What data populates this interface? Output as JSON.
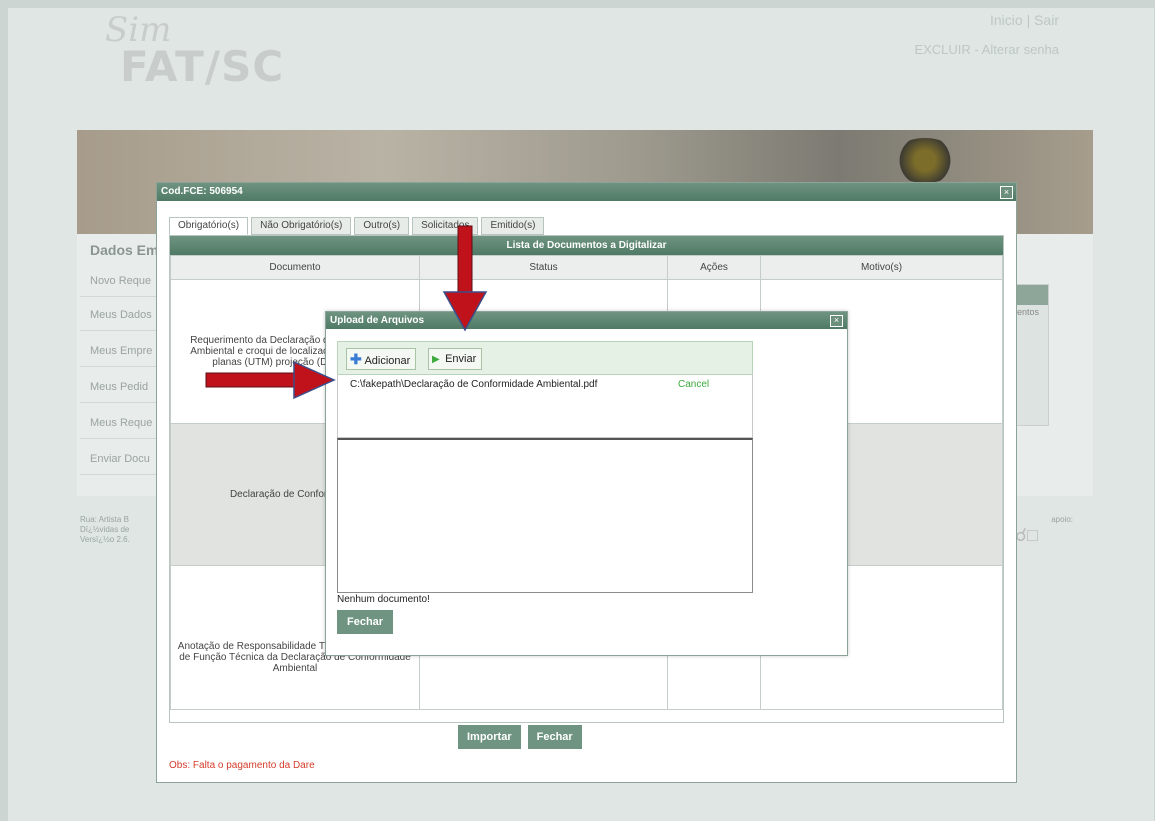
{
  "header": {
    "logo_script": "Sim",
    "logo_text": "FAT/SC",
    "link_inicio": "Inicio",
    "sep": "|",
    "link_sair": "Sair",
    "link_excluir": "EXCLUIR",
    "dash": "-",
    "link_senha": "Alterar senha"
  },
  "sidebar": {
    "title": "Dados Em",
    "items": [
      "Novo Reque",
      "Meus Dados",
      "Meus Empre",
      "Meus Pedid",
      "Meus Reque",
      "Enviar Docu"
    ]
  },
  "footer": {
    "line1": "Rua: Artista B",
    "line2": "Dï¿½vidas de",
    "line3": "Versï¿½o 2.6.",
    "apoio": "apoio:"
  },
  "right_stub": {
    "label": "entos"
  },
  "dialog": {
    "title": "Cod.FCE: 506954",
    "tabs": [
      "Obrigatório(s)",
      "Não Obrigatório(s)",
      "Outro(s)",
      "Solicitados",
      "Emitido(s)"
    ],
    "grid_caption": "Lista de Documentos a Digitalizar",
    "columns": [
      "Documento",
      "Status",
      "Ações",
      "Motivo(s)"
    ],
    "rows": [
      "Requerimento da Declaração de Conformidade Ambiental e croqui de localização coordenadas planas (UTM) projeção (DATUM) SIR",
      "Declaração de Conformidade",
      "Anotação de Responsabilidade Técnica ou Anotação de Função Técnica da Declaração de Conformidade Ambiental"
    ],
    "btn_importar": "Importar",
    "btn_fechar": "Fechar",
    "obs": "Obs: Falta o pagamento da Dare"
  },
  "upload": {
    "title": "Upload de Arquivos",
    "btn_adicionar": "Adicionar",
    "btn_enviar": "Enviar",
    "file_path": "C:\\fakepath\\Declaração de Conformidade Ambiental.pdf",
    "file_cancel": "Cancel",
    "empty_text": "Nenhum documento!",
    "btn_fechar": "Fechar"
  },
  "colors": {
    "titlebar": "#5c8571",
    "arrow_red": "#c0121b",
    "cancel_green": "#3daa3d",
    "obs_red": "#d53b2a"
  }
}
